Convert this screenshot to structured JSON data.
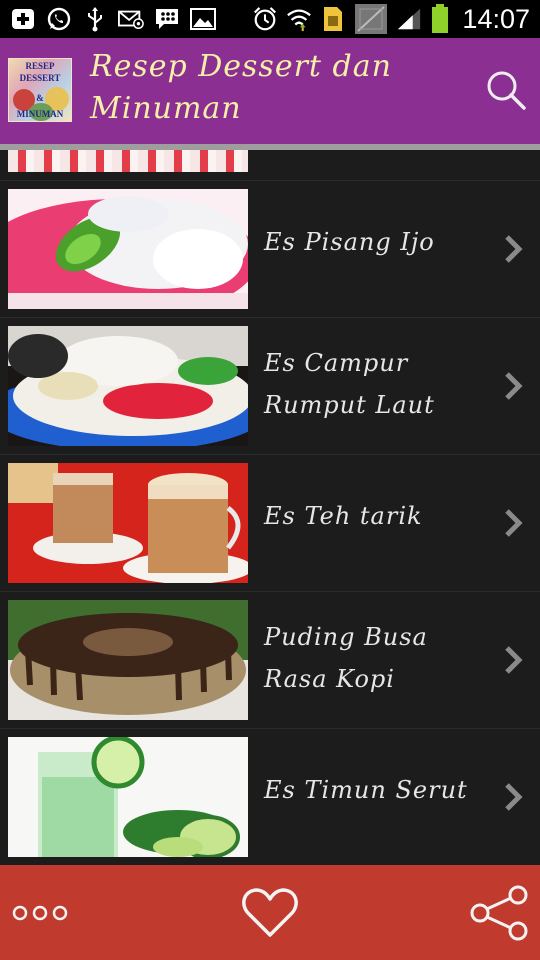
{
  "status_bar": {
    "time": "14:07",
    "left_icons": [
      "add-icon",
      "whatsapp-icon",
      "usb-icon",
      "email-icon",
      "bbm-icon",
      "image-icon"
    ],
    "right_icons": [
      "alarm-icon",
      "wifi-icon",
      "sim-icon",
      "signal-icon",
      "battery-icon"
    ]
  },
  "app_bar": {
    "title": "Resep Dessert dan Minuman",
    "logo_text": [
      "RESEP",
      "DESSERT",
      "&",
      "MINUMAN"
    ],
    "background": "#8c2f93",
    "title_color": "#f6f0a8"
  },
  "list": {
    "items": [
      {
        "label": "Es Pisang Ijo"
      },
      {
        "label": "Es Campur Rumput Laut"
      },
      {
        "label": "Es Teh tarik"
      },
      {
        "label": "Puding Busa Rasa Kopi"
      },
      {
        "label": "Es Timun Serut"
      }
    ]
  },
  "bottom_bar": {
    "background": "#c13a2e",
    "actions": [
      "more-options-icon",
      "favorite-icon",
      "share-icon"
    ]
  }
}
